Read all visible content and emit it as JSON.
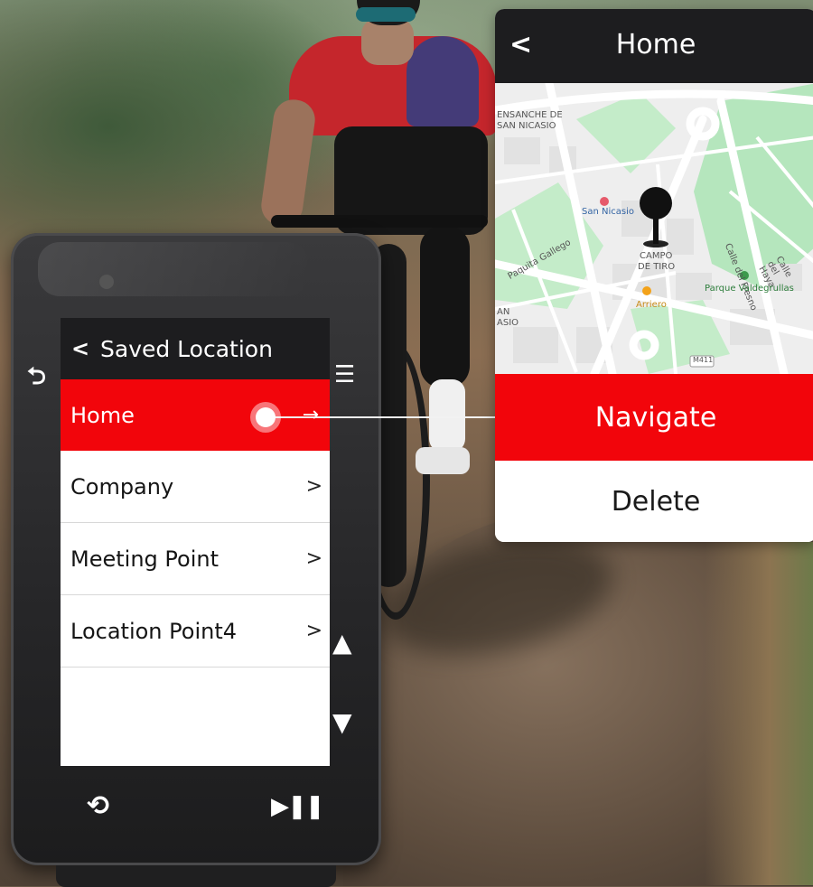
{
  "device": {
    "screen_title": "Saved Location",
    "items": [
      {
        "label": "Home",
        "selected": true
      },
      {
        "label": "Company",
        "selected": false
      },
      {
        "label": "Meeting Point",
        "selected": false
      },
      {
        "label": "Location Point4",
        "selected": false
      }
    ],
    "icons": {
      "back": "back-arrow-icon",
      "menu": "menu-icon",
      "up": "up-arrow-icon",
      "down": "down-arrow-icon",
      "loop": "loop-icon",
      "play_pause": "play-pause-icon"
    }
  },
  "popup": {
    "title": "Home",
    "navigate_label": "Navigate",
    "delete_label": "Delete",
    "map": {
      "labels": {
        "ensanche_1": "ENSANCHE DE",
        "ensanche_2": "SAN NICASIO",
        "san_nicasio": "San Nicasio",
        "paquita": "Paquita Gallego",
        "campo_1": "CAMPO",
        "campo_2": "DE TIRO",
        "fresno": "Calle del Fresno",
        "haya": "Calle del Haya",
        "parque": "Parque Valdegrullas",
        "arriero": "Arriero",
        "san_1": "AN",
        "san_2": "ASIO",
        "road": "M411"
      }
    }
  },
  "colors": {
    "accent_red": "#f2050b",
    "header_dark": "#1d1d1f",
    "map_green": "#b5e6bd",
    "map_base": "#eeeeee"
  }
}
